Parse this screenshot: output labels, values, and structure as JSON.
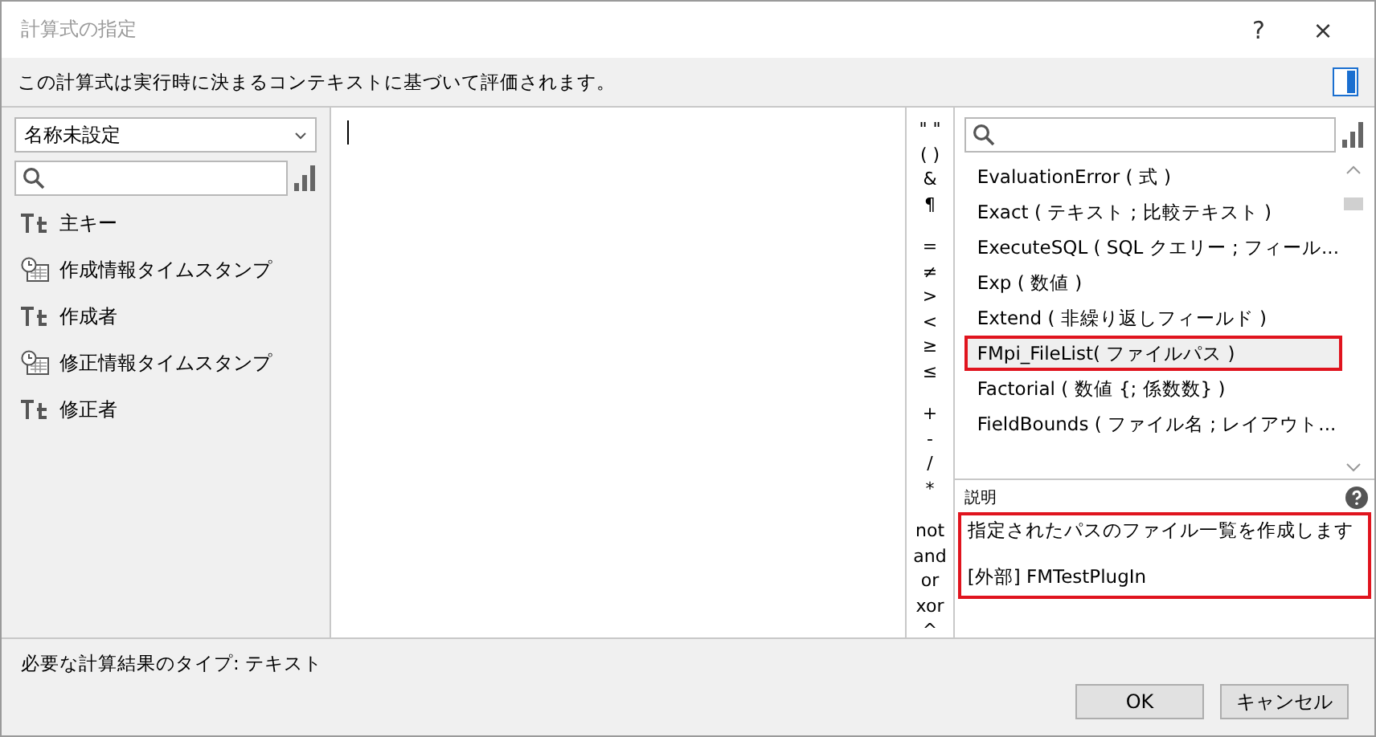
{
  "window": {
    "title": "計算式の指定",
    "help": "?",
    "close": "×"
  },
  "context_note": "この計算式は実行時に決まるコンテキストに基づいて評価されます。",
  "table_selector": {
    "value": "名称未設定"
  },
  "fields": [
    {
      "name": "主キー",
      "kind": "text"
    },
    {
      "name": "作成情報タイムスタンプ",
      "kind": "timestamp"
    },
    {
      "name": "作成者",
      "kind": "text"
    },
    {
      "name": "修正情報タイムスタンプ",
      "kind": "timestamp"
    },
    {
      "name": "修正者",
      "kind": "text"
    }
  ],
  "operators": [
    [
      "\" \"",
      "( )",
      "&",
      "¶"
    ],
    [
      "=",
      "≠",
      ">",
      "<",
      "≥",
      "≤"
    ],
    [
      "+",
      "-",
      "/",
      "*"
    ],
    [
      "not",
      "and",
      "or",
      "xor",
      "^"
    ]
  ],
  "functions": [
    {
      "label": "EvaluationError ( 式 )",
      "selected": false,
      "highlighted": false
    },
    {
      "label": "Exact ( テキスト ; 比較テキスト )",
      "selected": false,
      "highlighted": false
    },
    {
      "label": "ExecuteSQL ( SQL クエリー ; フィール...",
      "selected": false,
      "highlighted": false
    },
    {
      "label": "Exp ( 数値 )",
      "selected": false,
      "highlighted": false
    },
    {
      "label": "Extend ( 非繰り返しフィールド )",
      "selected": false,
      "highlighted": false
    },
    {
      "label": "FMpi_FileList( ファイルパス )",
      "selected": true,
      "highlighted": true
    },
    {
      "label": "Factorial ( 数値 {; 係数数} )",
      "selected": false,
      "highlighted": false
    },
    {
      "label": "FieldBounds ( ファイル名 ; レイアウト...",
      "selected": false,
      "highlighted": false
    }
  ],
  "description": {
    "heading": "説明",
    "highlighted": true,
    "lines": [
      "指定されたパスのファイル一覧を作成します",
      "[外部] FMTestPlugIn"
    ]
  },
  "result_type": "必要な計算結果のタイプ: テキスト",
  "buttons": [
    "OK",
    "キャンセル"
  ]
}
